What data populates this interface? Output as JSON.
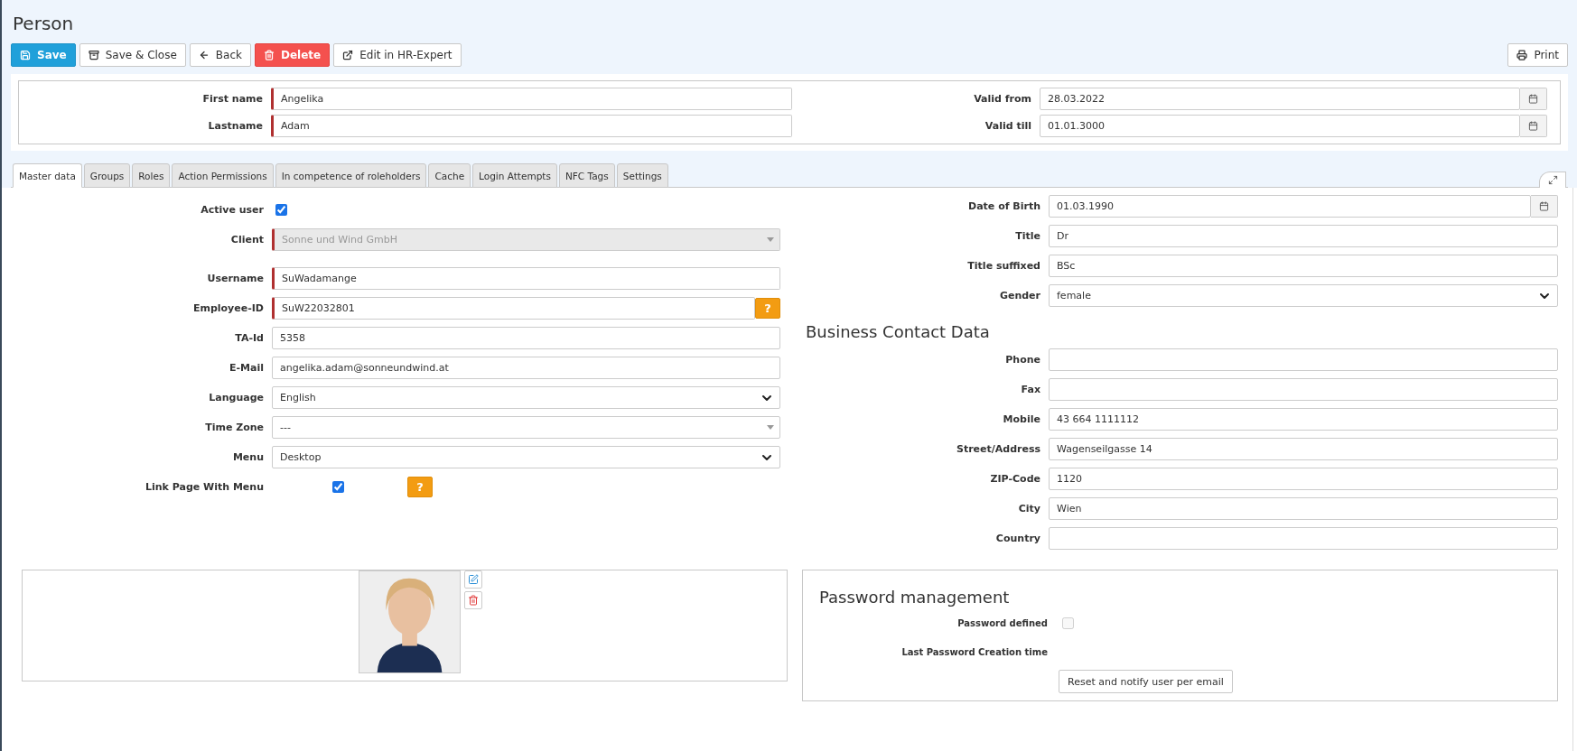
{
  "title": "Person",
  "toolbar": {
    "left": [
      {
        "label": "Save",
        "kind": "primary"
      },
      {
        "label": "Save & Close",
        "kind": "default"
      },
      {
        "label": "Back",
        "kind": "default"
      },
      {
        "label": "Delete",
        "kind": "danger"
      },
      {
        "label": "Edit in HR-Expert",
        "kind": "default"
      }
    ],
    "right": [
      {
        "label": "Print"
      }
    ]
  },
  "header": {
    "left": [
      {
        "label": "First name",
        "kind": "text",
        "value": "Angelika",
        "required": true,
        "disabled": false
      },
      {
        "label": "Lastname",
        "kind": "text",
        "value": "Adam",
        "required": true,
        "disabled": false
      }
    ],
    "right": [
      {
        "label": "Valid from",
        "kind": "date",
        "value": "28.03.2022",
        "required": false,
        "disabled": false
      },
      {
        "label": "Valid till",
        "kind": "date",
        "value": "01.01.3000",
        "required": false,
        "disabled": false
      }
    ]
  },
  "tabs": [
    {
      "label": "Master data",
      "selected": true
    },
    {
      "label": "Groups",
      "selected": false
    },
    {
      "label": "Roles",
      "selected": false
    },
    {
      "label": "Action Permissions",
      "selected": false
    },
    {
      "label": "In competence of roleholders",
      "selected": false
    },
    {
      "label": "Cache",
      "selected": false
    },
    {
      "label": "Login Attempts",
      "selected": false
    },
    {
      "label": "NFC Tags",
      "selected": false
    },
    {
      "label": "Settings",
      "selected": false
    }
  ],
  "master_data": {
    "left": [
      {
        "label": "Active user",
        "kind": "checkbox",
        "checked": true
      },
      {
        "label": "Client",
        "kind": "combo",
        "value": "Sonne und Wind GmbH",
        "required": true,
        "disabled": true
      },
      {
        "label": "Username",
        "kind": "text",
        "value": "SuWadamange",
        "required": true,
        "disabled": false
      },
      {
        "label": "Employee-ID",
        "kind": "text",
        "value": "SuW22032801",
        "required": true,
        "disabled": false,
        "help": "?"
      },
      {
        "label": "TA-Id",
        "kind": "text",
        "value": "5358",
        "required": false,
        "disabled": false
      },
      {
        "label": "E-Mail",
        "kind": "text",
        "value": "angelika.adam@sonneundwind.at",
        "required": false,
        "disabled": false
      },
      {
        "label": "Language",
        "kind": "select",
        "value": "English",
        "required": false,
        "disabled": false
      },
      {
        "label": "Time Zone",
        "kind": "combo",
        "value": "---",
        "required": false,
        "disabled": false
      },
      {
        "label": "Menu",
        "kind": "select",
        "value": "Desktop",
        "required": false,
        "disabled": false
      },
      {
        "label": "Link Page With Menu",
        "kind": "checkbox",
        "checked": true,
        "help": "?"
      }
    ],
    "right": [
      {
        "label": "Date of Birth",
        "kind": "date",
        "value": "01.03.1990",
        "required": false,
        "disabled": false
      },
      {
        "label": "Title",
        "kind": "text",
        "value": "Dr",
        "required": false,
        "disabled": false
      },
      {
        "label": "Title suffixed",
        "kind": "text",
        "value": "BSc",
        "required": false,
        "disabled": false
      },
      {
        "label": "Gender",
        "kind": "select",
        "value": "female",
        "required": false,
        "disabled": false
      }
    ],
    "contact_heading": "Business Contact Data",
    "contact": [
      {
        "label": "Phone",
        "kind": "text",
        "required": false,
        "disabled": false
      },
      {
        "label": "Fax",
        "kind": "text",
        "required": false,
        "disabled": false
      },
      {
        "label": "Mobile",
        "kind": "text",
        "value": "43 664 1111112",
        "required": false,
        "disabled": false
      },
      {
        "label": "Street/Address",
        "kind": "text",
        "value": "Wagenseilgasse 14",
        "required": false,
        "disabled": false
      },
      {
        "label": "ZIP-Code",
        "kind": "text",
        "value": "1120",
        "required": false,
        "disabled": false
      },
      {
        "label": "City",
        "kind": "text",
        "value": "Wien",
        "required": false,
        "disabled": false
      },
      {
        "label": "Country",
        "kind": "text",
        "required": false,
        "disabled": false
      }
    ]
  },
  "password": {
    "heading": "Password management",
    "rows": [
      {
        "label": "Password defined",
        "kind": "checkbox",
        "checked": false,
        "disabled": true
      },
      {
        "label": "Last Password Creation time",
        "kind": "static"
      }
    ],
    "button": "Reset and notify user per email"
  }
}
